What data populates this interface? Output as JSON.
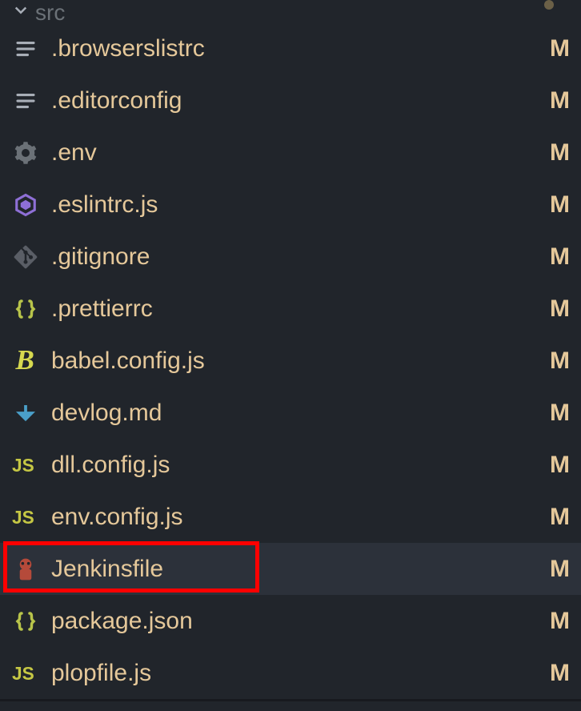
{
  "folder": {
    "name": "src",
    "expanded": true
  },
  "files": [
    {
      "name": ".browserslistrc",
      "icon": "lines-icon",
      "status": "M",
      "iconColor": "#a8aeb7"
    },
    {
      "name": ".editorconfig",
      "icon": "lines-icon",
      "status": "M",
      "iconColor": "#a8aeb7"
    },
    {
      "name": ".env",
      "icon": "gear-icon",
      "status": "M",
      "iconColor": "#6b7177"
    },
    {
      "name": ".eslintrc.js",
      "icon": "eslint-icon",
      "status": "M",
      "iconColor": "#8e6fd6"
    },
    {
      "name": ".gitignore",
      "icon": "git-icon",
      "status": "M",
      "iconColor": "#5a5e66"
    },
    {
      "name": ".prettierrc",
      "icon": "braces-icon",
      "status": "M",
      "iconColor": "#b8c44a"
    },
    {
      "name": "babel.config.js",
      "icon": "babel-icon",
      "status": "M",
      "iconColor": "#d6d94f"
    },
    {
      "name": "devlog.md",
      "icon": "markdown-icon",
      "status": "M",
      "iconColor": "#4a9fc9"
    },
    {
      "name": "dll.config.js",
      "icon": "js-icon",
      "status": "M",
      "iconColor": "#c5c744"
    },
    {
      "name": "env.config.js",
      "icon": "js-icon",
      "status": "M",
      "iconColor": "#c5c744"
    },
    {
      "name": "Jenkinsfile",
      "icon": "jenkins-icon",
      "status": "M",
      "iconColor": "#b54a3a",
      "selected": true,
      "highlighted": true
    },
    {
      "name": "package.json",
      "icon": "braces-icon",
      "status": "M",
      "iconColor": "#b8c44a"
    },
    {
      "name": "plopfile.js",
      "icon": "js-icon",
      "status": "M",
      "iconColor": "#c5c744"
    }
  ]
}
